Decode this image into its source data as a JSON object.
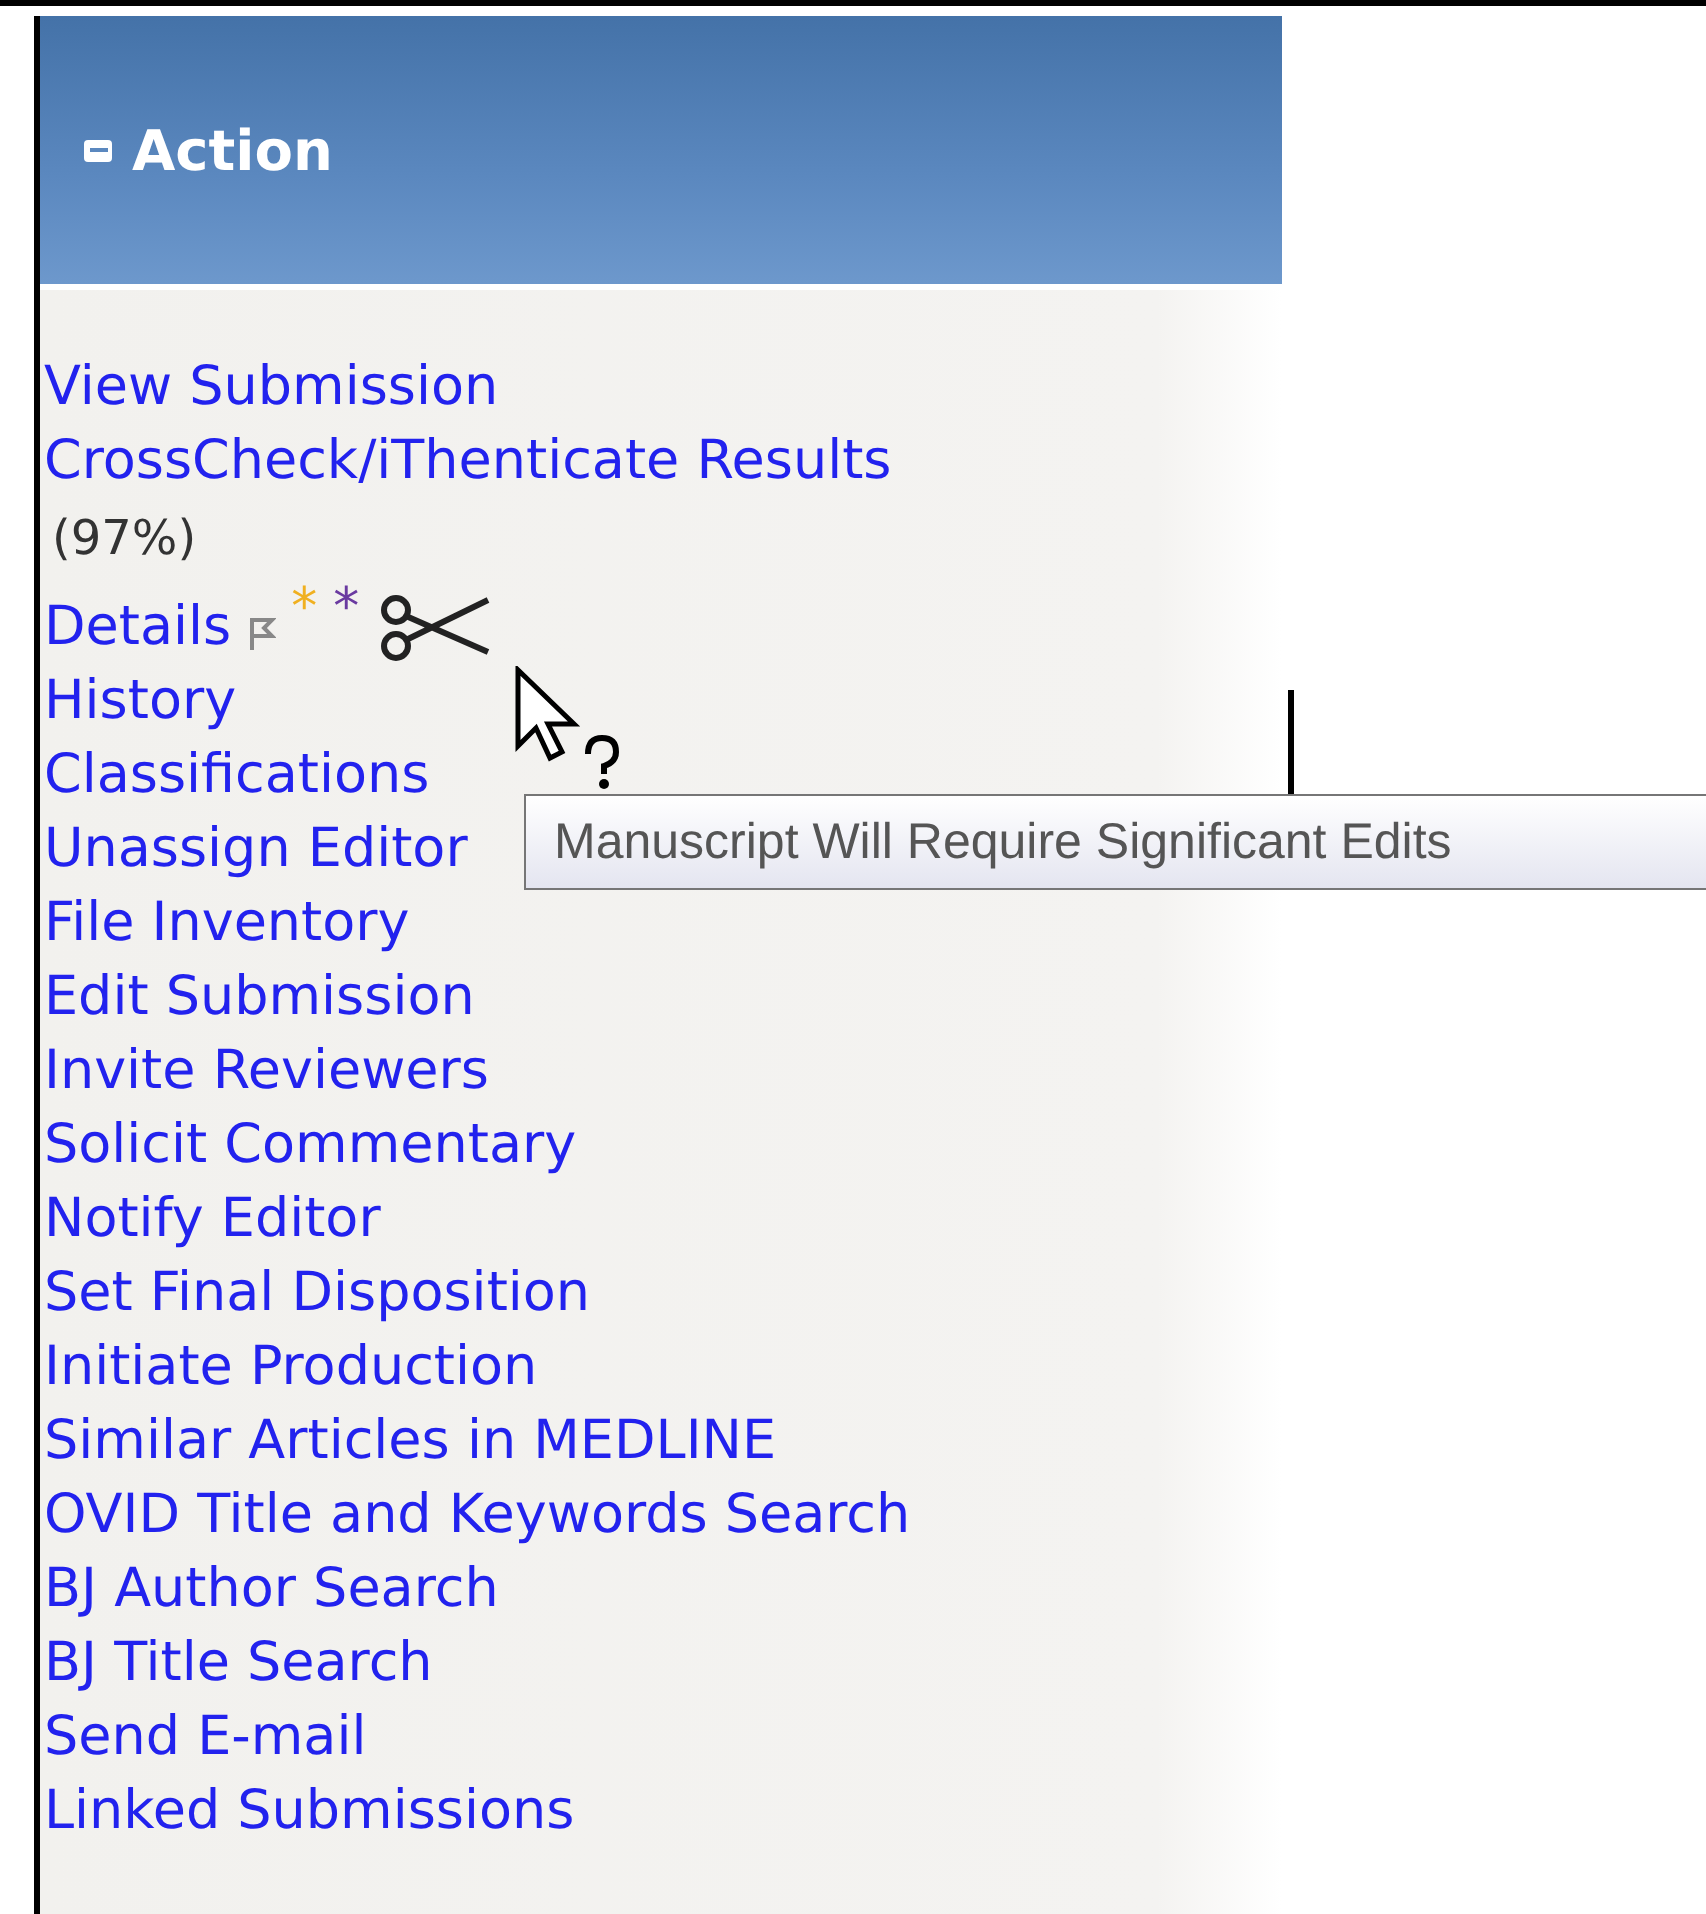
{
  "panel": {
    "title": "Action",
    "expanded": true
  },
  "links_top": [
    "View Submission",
    "CrossCheck/iThenticate Results"
  ],
  "similarity": "(97%)",
  "details": {
    "label": "Details",
    "markers": [
      {
        "symbol": "*",
        "color": "#f0b020"
      },
      {
        "symbol": "*",
        "color": "#6a3aa0"
      }
    ]
  },
  "links": [
    "History",
    "Classifications",
    "Unassign Editor",
    "File Inventory",
    "Edit Submission",
    "Invite Reviewers",
    "Solicit Commentary",
    "Notify Editor",
    "Set Final Disposition",
    "Initiate Production",
    "Similar Articles in MEDLINE",
    "OVID Title and Keywords Search",
    "BJ Author Search",
    "BJ Title Search",
    "Send E-mail",
    "Linked Submissions"
  ],
  "tooltip": "Manuscript Will Require Significant Edits"
}
